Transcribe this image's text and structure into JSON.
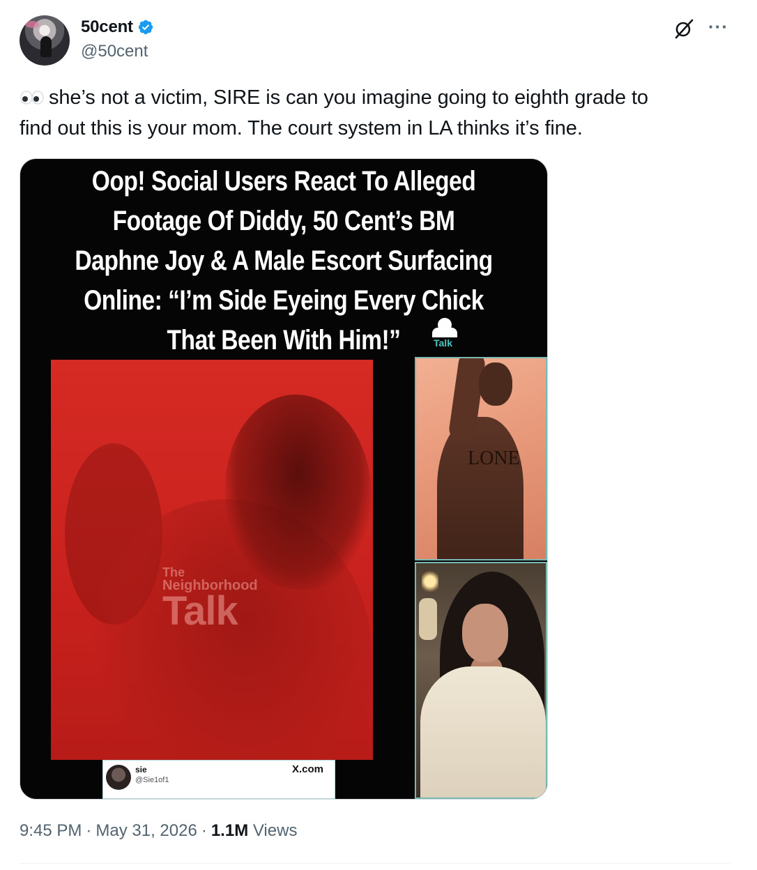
{
  "author": {
    "display_name": "50cent",
    "handle": "@50cent",
    "verified": true,
    "verified_color": "#1d9bf0",
    "avatar_icon": "avatar-concert-photo"
  },
  "header_actions": {
    "grok_icon": "grok-icon",
    "more_label": "···"
  },
  "tweet": {
    "emoji": "eyes-emoji",
    "text_line1": "she’s not a victim, SIRE is can you imagine going to eighth grade to",
    "text_line2": "find out this is your mom. The court system in LA thinks it’s fine."
  },
  "media": {
    "headline_lines": [
      "Oop! Social Users React To Alleged",
      "Footage Of Diddy, 50 Cent’s BM",
      "Daphne Joy & A Male Escort Surfacing",
      "Online: “I’m Side Eyeing Every Chick",
      "That Been With Him!”"
    ],
    "logo_word": "Talk",
    "watermark": {
      "line1": "The",
      "line2": "Neighborhood",
      "line3": "Talk"
    },
    "embedded_card": {
      "name": "sie",
      "handle": "@Sie1of1",
      "source": "X.com"
    },
    "tattoo_text": "LONE"
  },
  "meta": {
    "time": "9:45 PM",
    "date": "May 31, 2026",
    "separator": "·",
    "views_count": "1.1M",
    "views_label": "Views"
  }
}
